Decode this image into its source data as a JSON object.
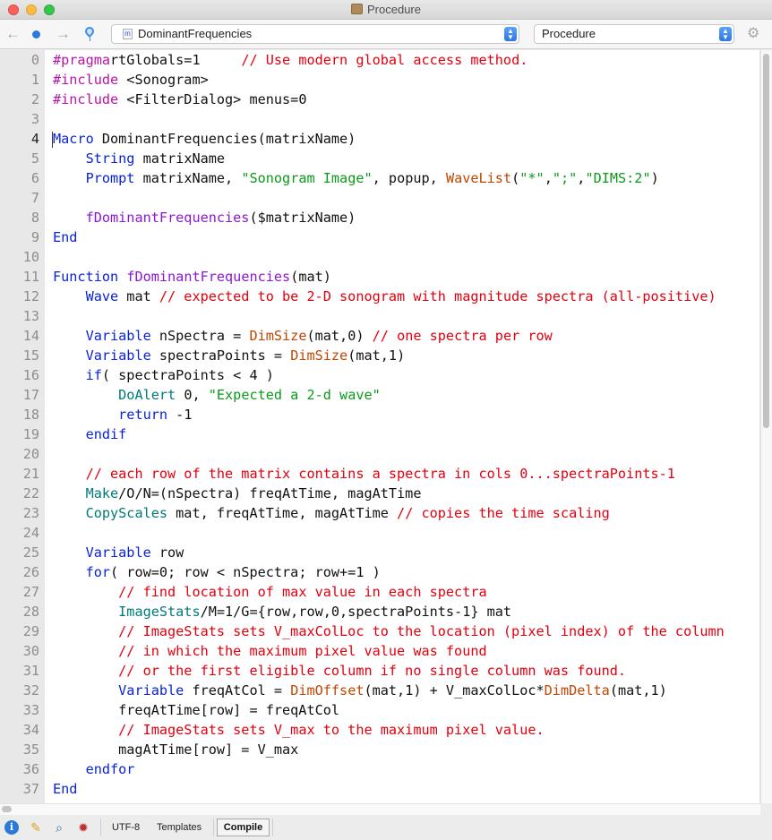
{
  "window": {
    "title": "Procedure"
  },
  "toolbar": {
    "back_icon": "arrow-left",
    "forward_icon": "arrow-right",
    "procedure_select": {
      "value": "DominantFrequencies",
      "icon_letter": "m"
    },
    "kind_select": {
      "value": "Procedure"
    }
  },
  "editor": {
    "current_line": 4,
    "lines": [
      {
        "n": "0",
        "segs": [
          [
            "pp",
            "#pragma"
          ],
          [
            "",
            "rtGlobals=1     "
          ],
          [
            "c",
            "// Use modern global access method."
          ]
        ]
      },
      {
        "n": "1",
        "segs": [
          [
            "pp",
            "#include"
          ],
          [
            "",
            " <Sonogram>"
          ]
        ]
      },
      {
        "n": "2",
        "segs": [
          [
            "pp",
            "#include"
          ],
          [
            "",
            " <FilterDialog> menus=0"
          ]
        ]
      },
      {
        "n": "3",
        "segs": []
      },
      {
        "n": "4",
        "segs": [
          [
            "k",
            "Macro"
          ],
          [
            "",
            " DominantFrequencies(matrixName)"
          ]
        ]
      },
      {
        "n": "5",
        "segs": [
          [
            "",
            "    "
          ],
          [
            "k",
            "String"
          ],
          [
            "",
            " matrixName"
          ]
        ]
      },
      {
        "n": "6",
        "segs": [
          [
            "",
            "    "
          ],
          [
            "k",
            "Prompt"
          ],
          [
            "",
            " matrixName, "
          ],
          [
            "s",
            "\"Sonogram Image\""
          ],
          [
            "",
            ", popup, "
          ],
          [
            "f",
            "WaveList"
          ],
          [
            "",
            "("
          ],
          [
            "s",
            "\"*\""
          ],
          [
            "",
            ","
          ],
          [
            "s",
            "\";\""
          ],
          [
            "",
            ","
          ],
          [
            "s",
            "\"DIMS:2\""
          ],
          [
            "",
            ")"
          ]
        ]
      },
      {
        "n": "7",
        "segs": []
      },
      {
        "n": "8",
        "segs": [
          [
            "",
            "    "
          ],
          [
            "u",
            "fDominantFrequencies"
          ],
          [
            "",
            "($matrixName)"
          ]
        ]
      },
      {
        "n": "9",
        "segs": [
          [
            "k",
            "End"
          ]
        ]
      },
      {
        "n": "10",
        "segs": []
      },
      {
        "n": "11",
        "segs": [
          [
            "k",
            "Function"
          ],
          [
            "",
            " "
          ],
          [
            "u",
            "fDominantFrequencies"
          ],
          [
            "",
            "(mat)"
          ]
        ]
      },
      {
        "n": "12",
        "segs": [
          [
            "",
            "    "
          ],
          [
            "k",
            "Wave"
          ],
          [
            "",
            " mat "
          ],
          [
            "c",
            "// expected to be 2-D sonogram with magnitude spectra (all-positive)"
          ]
        ]
      },
      {
        "n": "13",
        "segs": []
      },
      {
        "n": "14",
        "segs": [
          [
            "",
            "    "
          ],
          [
            "k",
            "Variable"
          ],
          [
            "",
            " nSpectra = "
          ],
          [
            "f",
            "DimSize"
          ],
          [
            "",
            "(mat,0) "
          ],
          [
            "c",
            "// one spectra per row"
          ]
        ]
      },
      {
        "n": "15",
        "segs": [
          [
            "",
            "    "
          ],
          [
            "k",
            "Variable"
          ],
          [
            "",
            " spectraPoints = "
          ],
          [
            "f",
            "DimSize"
          ],
          [
            "",
            "(mat,1)"
          ]
        ]
      },
      {
        "n": "16",
        "segs": [
          [
            "",
            "    "
          ],
          [
            "k",
            "if"
          ],
          [
            "",
            "( spectraPoints < 4 )"
          ]
        ]
      },
      {
        "n": "17",
        "segs": [
          [
            "",
            "        "
          ],
          [
            "o",
            "DoAlert"
          ],
          [
            "",
            " 0, "
          ],
          [
            "s",
            "\"Expected a 2-d wave\""
          ]
        ]
      },
      {
        "n": "18",
        "segs": [
          [
            "",
            "        "
          ],
          [
            "k",
            "return"
          ],
          [
            "",
            " -1"
          ]
        ]
      },
      {
        "n": "19",
        "segs": [
          [
            "",
            "    "
          ],
          [
            "k",
            "endif"
          ]
        ]
      },
      {
        "n": "20",
        "segs": []
      },
      {
        "n": "21",
        "segs": [
          [
            "",
            "    "
          ],
          [
            "c",
            "// each row of the matrix contains a spectra in cols 0...spectraPoints-1"
          ]
        ]
      },
      {
        "n": "22",
        "segs": [
          [
            "",
            "    "
          ],
          [
            "o",
            "Make"
          ],
          [
            "",
            "/O/N=(nSpectra) freqAtTime, magAtTime"
          ]
        ]
      },
      {
        "n": "23",
        "segs": [
          [
            "",
            "    "
          ],
          [
            "o",
            "CopyScales"
          ],
          [
            "",
            " mat, freqAtTime, magAtTime "
          ],
          [
            "c",
            "// copies the time scaling"
          ]
        ]
      },
      {
        "n": "24",
        "segs": []
      },
      {
        "n": "25",
        "segs": [
          [
            "",
            "    "
          ],
          [
            "k",
            "Variable"
          ],
          [
            "",
            " row"
          ]
        ]
      },
      {
        "n": "26",
        "segs": [
          [
            "",
            "    "
          ],
          [
            "k",
            "for"
          ],
          [
            "",
            "( row=0; row < nSpectra; row+=1 )"
          ]
        ]
      },
      {
        "n": "27",
        "segs": [
          [
            "",
            "        "
          ],
          [
            "c",
            "// find location of max value in each spectra"
          ]
        ]
      },
      {
        "n": "28",
        "segs": [
          [
            "",
            "        "
          ],
          [
            "o",
            "ImageStats"
          ],
          [
            "",
            "/M=1/G={row,row,0,spectraPoints-1} mat"
          ]
        ]
      },
      {
        "n": "29",
        "segs": [
          [
            "",
            "        "
          ],
          [
            "c",
            "// ImageStats sets V_maxColLoc to the location (pixel index) of the column"
          ]
        ]
      },
      {
        "n": "30",
        "segs": [
          [
            "",
            "        "
          ],
          [
            "c",
            "// in which the maximum pixel value was found"
          ]
        ]
      },
      {
        "n": "31",
        "segs": [
          [
            "",
            "        "
          ],
          [
            "c",
            "// or the first eligible column if no single column was found."
          ]
        ]
      },
      {
        "n": "32",
        "segs": [
          [
            "",
            "        "
          ],
          [
            "k",
            "Variable"
          ],
          [
            "",
            " freqAtCol = "
          ],
          [
            "f",
            "DimOffset"
          ],
          [
            "",
            "(mat,1) + V_maxColLoc*"
          ],
          [
            "f",
            "DimDelta"
          ],
          [
            "",
            "(mat,1)"
          ]
        ]
      },
      {
        "n": "33",
        "segs": [
          [
            "",
            "        freqAtTime[row] = freqAtCol"
          ]
        ]
      },
      {
        "n": "34",
        "segs": [
          [
            "",
            "        "
          ],
          [
            "c",
            "// ImageStats sets V_max to the maximum pixel value."
          ]
        ]
      },
      {
        "n": "35",
        "segs": [
          [
            "",
            "        magAtTime[row] = V_max"
          ]
        ]
      },
      {
        "n": "36",
        "segs": [
          [
            "",
            "    "
          ],
          [
            "k",
            "endfor"
          ]
        ]
      },
      {
        "n": "37",
        "segs": [
          [
            "k",
            "End"
          ]
        ]
      }
    ]
  },
  "statusbar": {
    "info_icon": "info-icon",
    "pencil_icon": "pencil-icon",
    "magnify_icon": "magnifier-icon",
    "bug_icon": "debugger-icon",
    "encoding": "UTF-8",
    "templates": "Templates",
    "compile": "Compile"
  }
}
